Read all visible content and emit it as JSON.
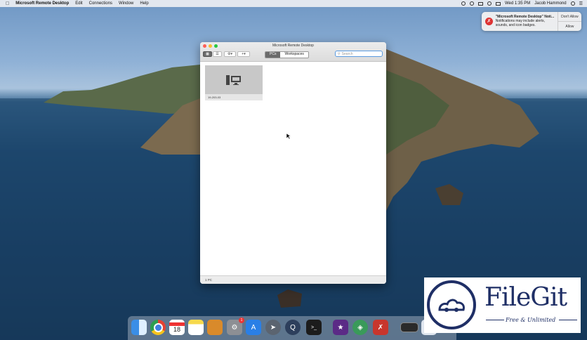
{
  "menubar": {
    "app_name": "Microsoft Remote Desktop",
    "menus": [
      "Edit",
      "Connections",
      "Window",
      "Help"
    ],
    "clock": "Wed 1:35 PM",
    "user": "Jacob Hammond"
  },
  "notification": {
    "title": "\"Microsoft Remote Desktop\" Noti...",
    "body": "Notifications may include alerts, sounds, and icon badges.",
    "dont_allow": "Don't Allow",
    "allow": "Allow"
  },
  "window": {
    "title": "Microsoft Remote Desktop",
    "tabs": [
      {
        "label": "PCs",
        "active": true
      },
      {
        "label": "Workspaces",
        "active": false
      }
    ],
    "search_placeholder": "Search",
    "pcs": [
      {
        "name": "19-203-03"
      }
    ],
    "status": "1 PC"
  },
  "dock": {
    "apps": [
      "finder-icon",
      "chrome-icon",
      "calendar-icon",
      "notes-icon",
      "books-icon",
      "system-preferences-icon",
      "app-store-icon",
      "launchpad-icon",
      "quicktime-icon",
      "terminal-icon",
      "imovie-icon",
      "network-icon",
      "remote-desktop-icon",
      "screenshot-icon",
      "downloads-icon"
    ],
    "calendar_day": "18",
    "badge_count": "1"
  },
  "watermark": {
    "brand": "FileGit",
    "tagline": "Free & Unlimited"
  },
  "colors": {
    "accent": "#5a9be0",
    "close": "#fe5f57",
    "minimize": "#febc2e",
    "zoom": "#28c840",
    "logo": "#1f2f66"
  }
}
